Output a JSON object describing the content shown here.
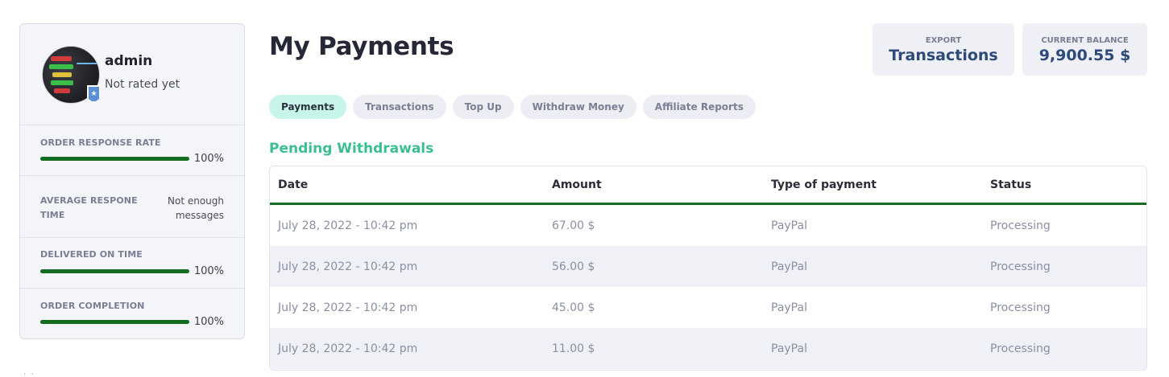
{
  "profile": {
    "username": "admin",
    "rating_text": "Not rated yet"
  },
  "stats": [
    {
      "label": "ORDER RESPONSE RATE",
      "value": "100%",
      "fraction": 1.0
    },
    {
      "label": "AVERAGE RESPONE TIME",
      "value": "Not enough messages"
    },
    {
      "label": "DELIVERED ON TIME",
      "value": "100%",
      "fraction": 1.0
    },
    {
      "label": "ORDER COMPLETION",
      "value": "100%",
      "fraction": 1.0
    }
  ],
  "header": {
    "title": "My Payments",
    "export": {
      "small": "EXPORT",
      "big": "Transactions"
    },
    "balance": {
      "small": "CURRENT BALANCE",
      "big": "9,900.55 $"
    }
  },
  "tabs": [
    {
      "label": "Payments",
      "active": true
    },
    {
      "label": "Transactions",
      "active": false
    },
    {
      "label": "Top Up",
      "active": false
    },
    {
      "label": "Withdraw Money",
      "active": false
    },
    {
      "label": "Affiliate Reports",
      "active": false
    }
  ],
  "section_title": "Pending Withdrawals",
  "table": {
    "columns": [
      "Date",
      "Amount",
      "Type of payment",
      "Status"
    ],
    "rows": [
      [
        "July 28, 2022 - 10:42 pm",
        "67.00 $",
        "PayPal",
        "Processing"
      ],
      [
        "July 28, 2022 - 10:42 pm",
        "56.00 $",
        "PayPal",
        "Processing"
      ],
      [
        "July 28, 2022 - 10:42 pm",
        "45.00 $",
        "PayPal",
        "Processing"
      ],
      [
        "July 28, 2022 - 10:42 pm",
        "11.00 $",
        "PayPal",
        "Processing"
      ]
    ]
  },
  "colors": {
    "accent_green": "#3cbf8e",
    "bar_green": "#136c1f",
    "active_tab_bg": "#c8f5ea",
    "balance_text": "#2d4a7a"
  },
  "icons": {
    "badge": "star-shield-icon"
  }
}
